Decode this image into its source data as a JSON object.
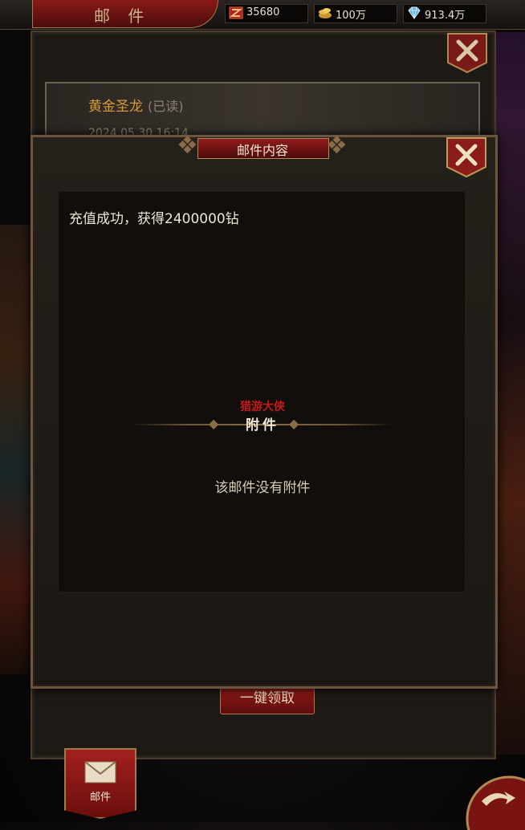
{
  "header": {
    "title": "邮 件",
    "resources": [
      {
        "icon": "ruby-icon",
        "value": "35680"
      },
      {
        "icon": "gold-coins-icon",
        "value": "100万"
      },
      {
        "icon": "diamond-icon",
        "value": "913.4万"
      }
    ]
  },
  "mail_list": {
    "items": [
      {
        "sender": "黄金圣龙",
        "status": "(已读)",
        "date": "2024.05.30 16:14"
      }
    ],
    "claim_all_label": "一键领取"
  },
  "dialog": {
    "title": "邮件内容",
    "message": "充值成功，获得2400000钻",
    "watermark": "猎游大侠",
    "attachment_header": "附件",
    "no_attachment_text": "该邮件没有附件"
  },
  "bottom_nav": {
    "mail_tab_label": "邮件"
  },
  "colors": {
    "accent_red": "#8f1c1a",
    "gold_text": "#d89a38",
    "frame": "#6a5640"
  }
}
